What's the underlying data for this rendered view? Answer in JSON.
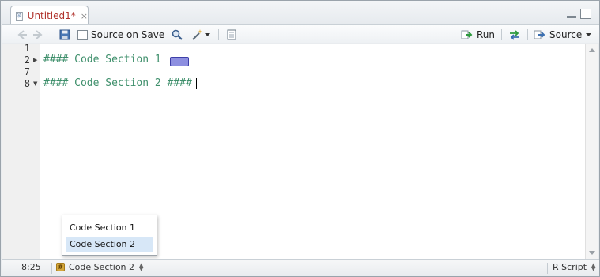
{
  "tab": {
    "title": "Untitled1*",
    "close": "×"
  },
  "toolbar": {
    "source_on_save": "Source on Save",
    "run": "Run",
    "source": "Source"
  },
  "editor": {
    "lines": [
      {
        "number": "1",
        "text": ""
      },
      {
        "number": "2",
        "text": "#### Code Section 1"
      },
      {
        "number": "7",
        "text": ""
      },
      {
        "number": "8",
        "text": "#### Code Section 2 ####"
      }
    ]
  },
  "popup": {
    "items": [
      "Code Section 1",
      "Code Section 2"
    ],
    "selected_index": 1
  },
  "status": {
    "position": "8:25",
    "section": "Code Section 2",
    "file_type": "R Script"
  },
  "colors": {
    "tab_title": "#b0312b",
    "code_comment": "#3e8f6b",
    "popup_selected": "#d7e7f7",
    "fold_marker": "#8d8fe0"
  }
}
